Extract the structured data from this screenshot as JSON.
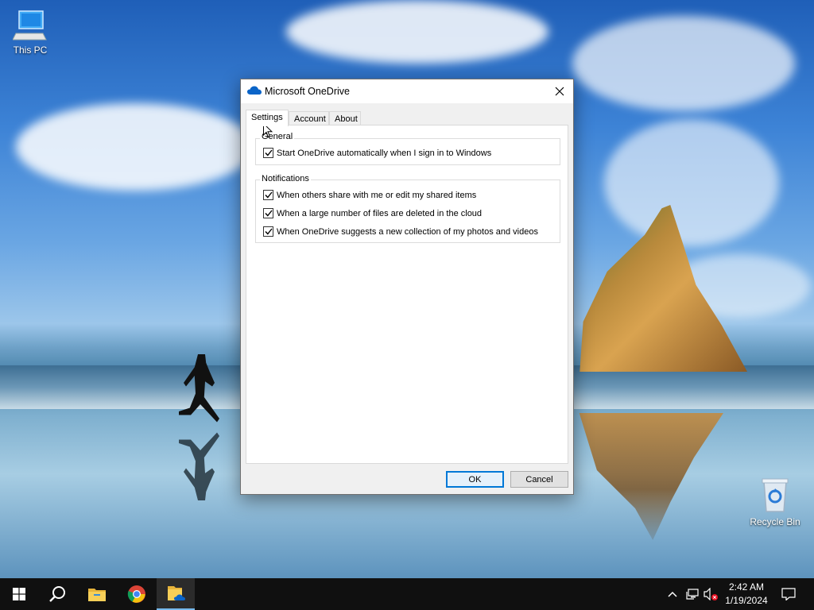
{
  "desktop": {
    "icons": [
      {
        "label": "This PC",
        "icon": "computer-icon"
      },
      {
        "label": "Recycle Bin",
        "icon": "recycle-bin-icon"
      }
    ]
  },
  "dialog": {
    "title": "Microsoft OneDrive",
    "title_icon": "onedrive-cloud-icon",
    "tabs": [
      {
        "label": "Settings",
        "active": true
      },
      {
        "label": "Account",
        "active": false
      },
      {
        "label": "About",
        "active": false
      }
    ],
    "groups": {
      "general": {
        "label": "General",
        "options": [
          {
            "label": "Start OneDrive automatically when I sign in to Windows",
            "checked": true
          }
        ]
      },
      "notifications": {
        "label": "Notifications",
        "options": [
          {
            "label": "When others share with me or edit my shared items",
            "checked": true
          },
          {
            "label": "When a large number of files are deleted in the cloud",
            "checked": true
          },
          {
            "label": "When OneDrive suggests a new collection of my photos and videos",
            "checked": true
          }
        ]
      }
    },
    "buttons": {
      "ok": "OK",
      "cancel": "Cancel"
    }
  },
  "taskbar": {
    "items": [
      "windows-start-icon",
      "search-icon",
      "file-explorer-icon",
      "chrome-icon",
      "onedrive-folder-icon"
    ],
    "tray": [
      "chevron-up-icon",
      "network-icon",
      "volume-muted-icon",
      "notification-icon"
    ],
    "time": "2:42 AM",
    "date": "1/19/2024"
  },
  "colors": {
    "accent": "#0078d7",
    "taskbar": "#101010"
  }
}
